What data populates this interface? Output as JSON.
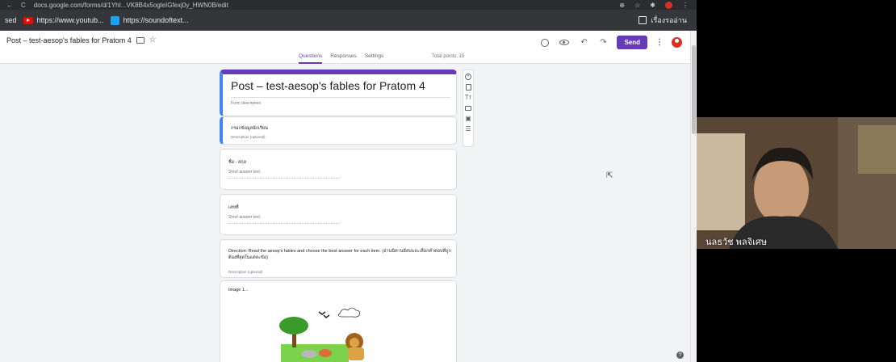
{
  "browser": {
    "url": "docs.google.com/forms/d/1YhI...VK8B4x5ogleIGfexj0y_HWN0B/edit",
    "bookmarks": [
      {
        "label": "sed",
        "icon": "none"
      },
      {
        "label": "https://www.youtub...",
        "icon": "youtube-icon"
      },
      {
        "label": "https://soundoftext...",
        "icon": "site-icon"
      }
    ],
    "reading_list": "เรื่องรออ่าน"
  },
  "form_header": {
    "doc_title": "Post – test-aesop's fables for Pratom 4",
    "send_label": "Send",
    "tabs": [
      {
        "label": "Questions",
        "active": true
      },
      {
        "label": "Responses",
        "active": false
      },
      {
        "label": "Settings",
        "active": false
      }
    ],
    "total_points": "Total points: 15"
  },
  "form": {
    "title": "Post – test-aesop's fables for Pratom 4",
    "description_placeholder": "Form description",
    "section": {
      "title": "กรอกข้อมูลนักเรียน",
      "description": "Description (optional)"
    },
    "questions": [
      {
        "title": "ชื่อ - สกุล",
        "answer_hint": "Short answer text"
      },
      {
        "title": "เลขที่",
        "answer_hint": "Short answer text"
      }
    ],
    "direction": {
      "text": "Direction: Read the aesop's fables and choose the best answer for each item. (อ่านนิทานอีสปและเลือกคำตอบที่ถูกต้องที่สุดในแต่ละข้อ)",
      "description": "Description (optional)"
    },
    "image_item_label": "Image 1..."
  },
  "accent_color": "#673ab7",
  "webcam": {
    "participant_name": "นลธวัช พลจิเศษ"
  }
}
